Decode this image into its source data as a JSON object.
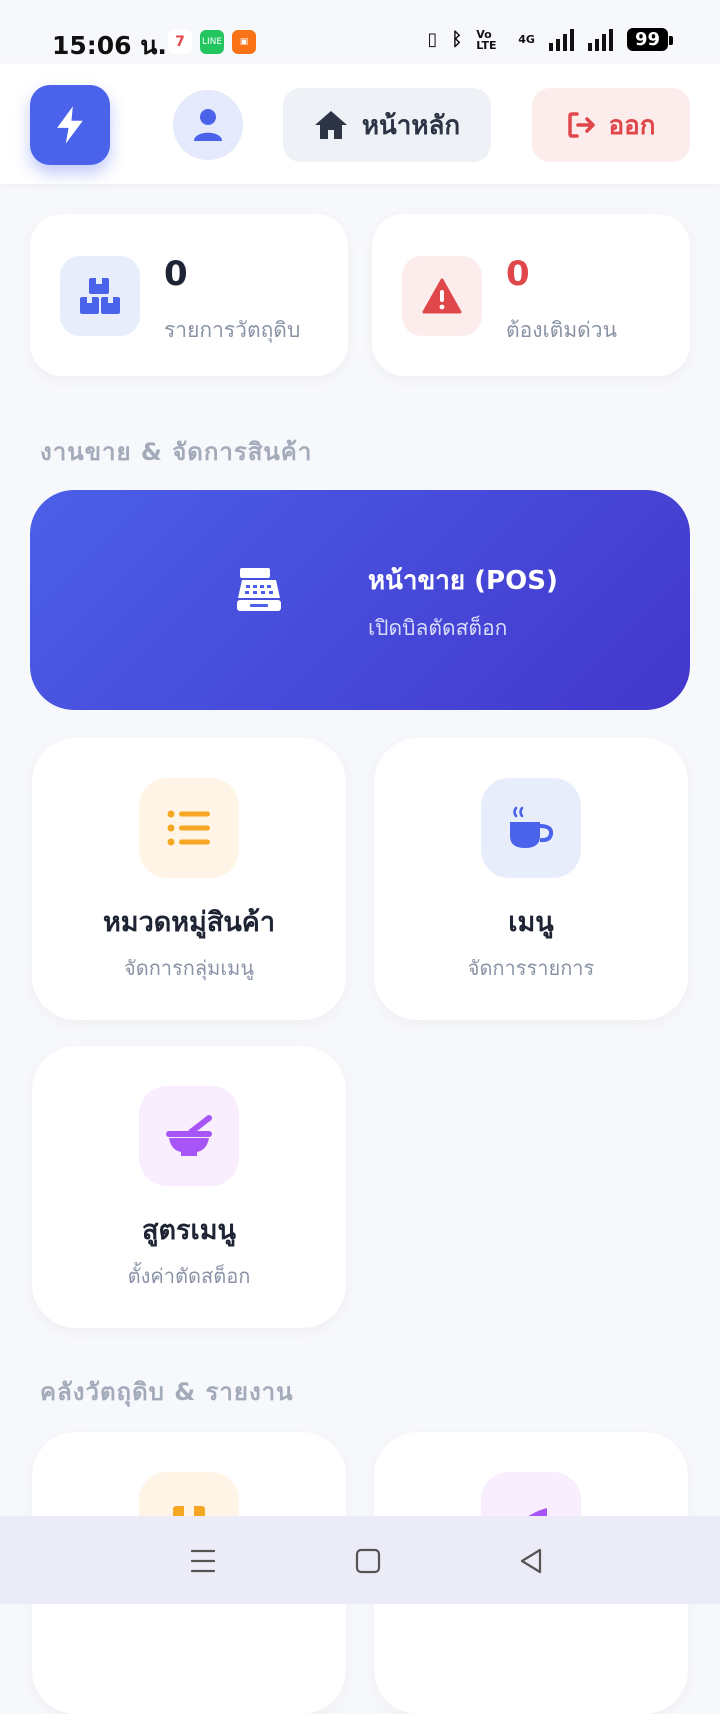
{
  "status_bar": {
    "time": "15:06 น.",
    "battery": "99",
    "network": "4G",
    "volte": "Vo LTE"
  },
  "header": {
    "home_label": "หน้าหลัก",
    "logout_label": "ออก"
  },
  "stats": [
    {
      "value": "0",
      "label": "รายการวัตถุดิบ",
      "value_color": "#1e2433"
    },
    {
      "value": "0",
      "label": "ต้องเติมด่วน",
      "value_color": "#e0474a"
    }
  ],
  "sections": {
    "sales": "งานขาย & จัดการสินค้า",
    "inventory": "คลังวัตถุดิบ & รายงาน"
  },
  "pos": {
    "title": "หน้าขาย (POS)",
    "subtitle": "เปิดบิลตัดสต็อก"
  },
  "menu_cards": [
    {
      "title": "หมวดหมู่สินค้า",
      "subtitle": "จัดการกลุ่มเมนู",
      "icon": "list-icon"
    },
    {
      "title": "เมนู",
      "subtitle": "จัดการรายการ",
      "icon": "coffee-icon"
    },
    {
      "title": "สูตรเมนู",
      "subtitle": "ตั้งค่าตัดสต็อก",
      "icon": "mortar-pestle-icon"
    }
  ],
  "colors": {
    "accent": "#4a63ea",
    "danger": "#e0474a",
    "orange": "#f5a623",
    "purple": "#a855f7"
  }
}
